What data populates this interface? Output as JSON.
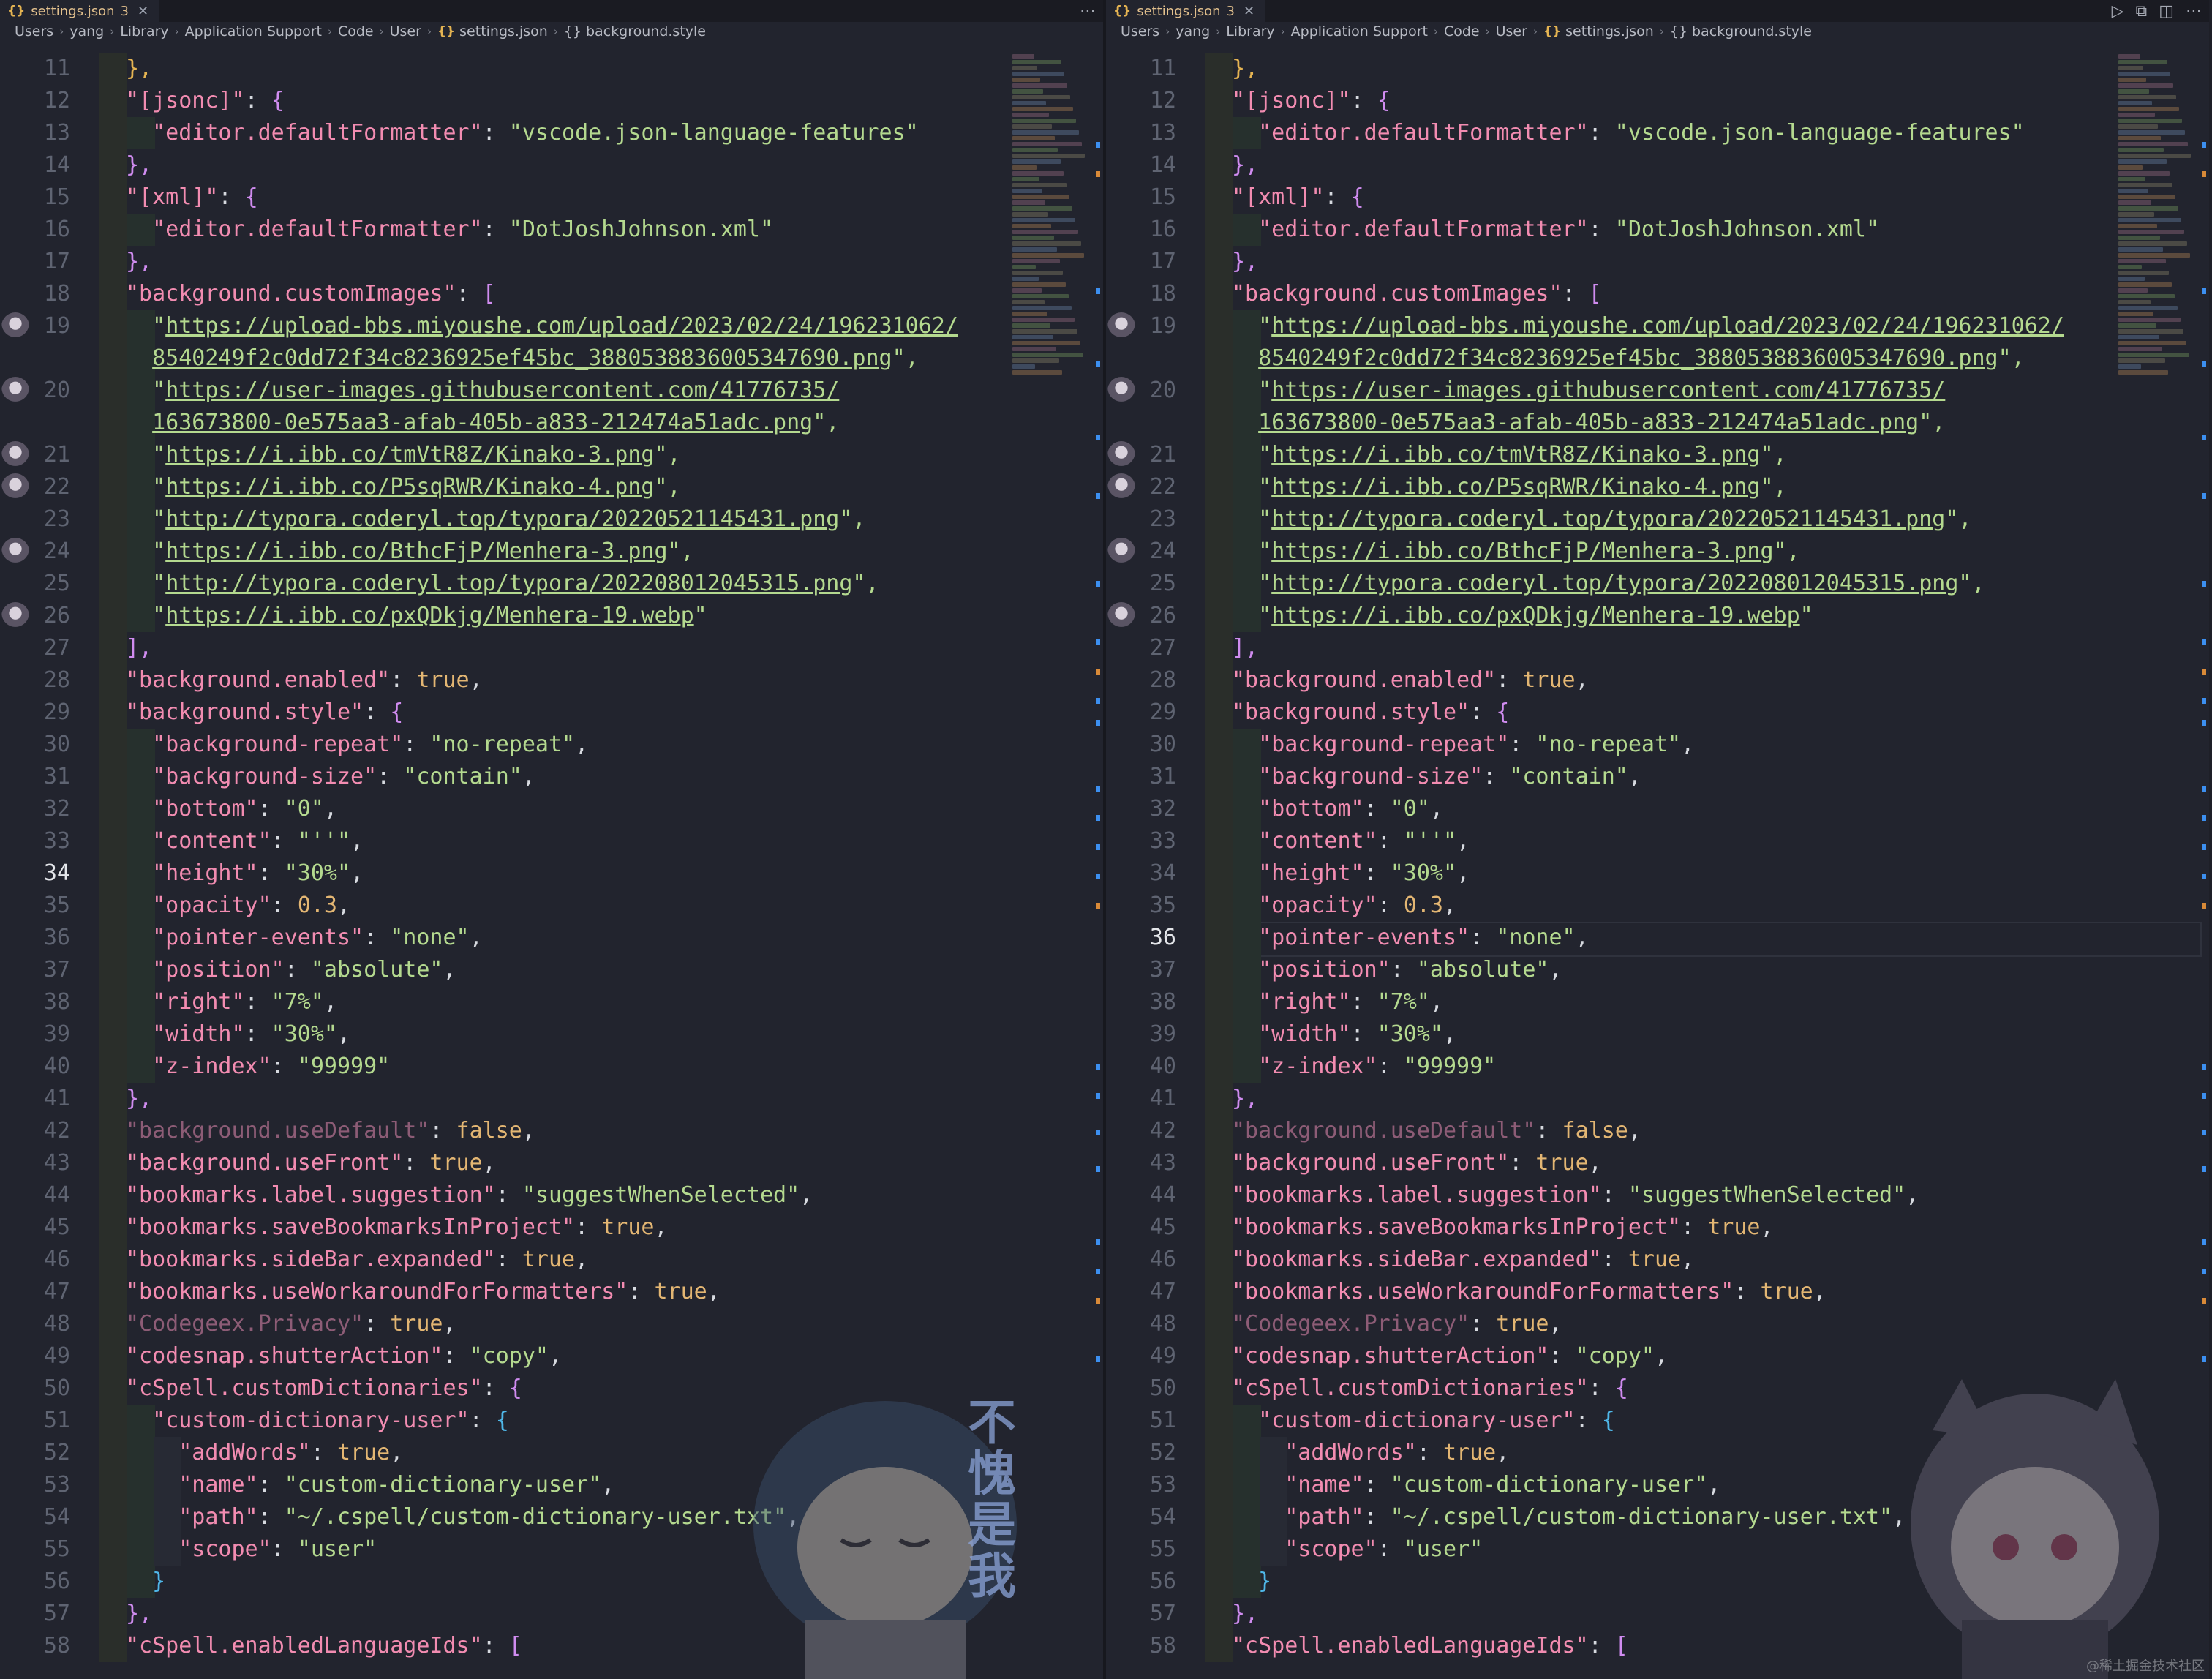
{
  "tab": {
    "icon": "{}",
    "filename": "settings.json",
    "problem_count": "3"
  },
  "breadcrumb": {
    "segments": [
      "Users",
      "yang",
      "Library",
      "Application Support",
      "Code",
      "User"
    ],
    "file": "settings.json",
    "symbol_icon": "{}",
    "symbol": "background.style"
  },
  "lines": [
    {
      "n": 11,
      "spans": [
        [
          "},",
          "brace"
        ]
      ]
    },
    {
      "n": 12,
      "spans": [
        [
          "\"[jsonc]\"",
          "key"
        ],
        [
          ": ",
          "punc"
        ],
        [
          "{",
          "brace2"
        ]
      ]
    },
    {
      "n": 13,
      "spans": [
        [
          "  \"editor.defaultFormatter\"",
          "key"
        ],
        [
          ": ",
          "punc"
        ],
        [
          "\"vscode.json-language-features\"",
          "str"
        ]
      ]
    },
    {
      "n": 14,
      "spans": [
        [
          "},",
          "brace2"
        ]
      ]
    },
    {
      "n": 15,
      "spans": [
        [
          "\"[xml]\"",
          "key"
        ],
        [
          ": ",
          "punc"
        ],
        [
          "{",
          "brace2"
        ]
      ]
    },
    {
      "n": 16,
      "spans": [
        [
          "  \"editor.defaultFormatter\"",
          "key"
        ],
        [
          ": ",
          "punc"
        ],
        [
          "\"DotJoshJohnson.xml\"",
          "str"
        ]
      ]
    },
    {
      "n": 17,
      "spans": [
        [
          "},",
          "brace2"
        ]
      ]
    },
    {
      "n": 18,
      "spans": [
        [
          "\"background.customImages\"",
          "key"
        ],
        [
          ": ",
          "punc"
        ],
        [
          "[",
          "brace2"
        ]
      ]
    },
    {
      "n": 19,
      "spans": [
        [
          "  \"",
          "str"
        ],
        [
          "https://upload-bbs.miyoushe.com/upload/2023/02/24/196231062/",
          "url"
        ]
      ]
    },
    {
      "n": null,
      "spans": [
        [
          "  ",
          "punc"
        ],
        [
          "8540249f2c0dd72f34c8236925ef45bc_3880538836005347690.png",
          "url"
        ],
        [
          "\",",
          "str"
        ]
      ]
    },
    {
      "n": 20,
      "spans": [
        [
          "  \"",
          "str"
        ],
        [
          "https://user-images.githubusercontent.com/41776735/",
          "url"
        ]
      ]
    },
    {
      "n": null,
      "spans": [
        [
          "  ",
          "punc"
        ],
        [
          "163673800-0e575aa3-afab-405b-a833-212474a51adc.png",
          "url"
        ],
        [
          "\",",
          "str"
        ]
      ]
    },
    {
      "n": 21,
      "spans": [
        [
          "  \"",
          "str"
        ],
        [
          "https://i.ibb.co/tmVtR8Z/Kinako-3.png",
          "url"
        ],
        [
          "\",",
          "str"
        ]
      ]
    },
    {
      "n": 22,
      "spans": [
        [
          "  \"",
          "str"
        ],
        [
          "https://i.ibb.co/P5sqRWR/Kinako-4.png",
          "url"
        ],
        [
          "\",",
          "str"
        ]
      ]
    },
    {
      "n": 23,
      "spans": [
        [
          "  \"",
          "str"
        ],
        [
          "http://typora.coderyl.top/typora/20220521145431.png",
          "url"
        ],
        [
          "\",",
          "str"
        ]
      ]
    },
    {
      "n": 24,
      "spans": [
        [
          "  \"",
          "str"
        ],
        [
          "https://i.ibb.co/BthcFjP/Menhera-3.png",
          "url"
        ],
        [
          "\",",
          "str"
        ]
      ]
    },
    {
      "n": 25,
      "spans": [
        [
          "  \"",
          "str"
        ],
        [
          "http://typora.coderyl.top/typora/202208012045315.png",
          "url"
        ],
        [
          "\",",
          "str"
        ]
      ]
    },
    {
      "n": 26,
      "spans": [
        [
          "  \"",
          "str"
        ],
        [
          "https://i.ibb.co/pxQDkjg/Menhera-19.webp",
          "url"
        ],
        [
          "\"",
          "str"
        ]
      ]
    },
    {
      "n": 27,
      "spans": [
        [
          "],",
          "brace2"
        ]
      ]
    },
    {
      "n": 28,
      "spans": [
        [
          "\"background.enabled\"",
          "key"
        ],
        [
          ": ",
          "punc"
        ],
        [
          "true",
          "bool"
        ],
        [
          ",",
          "punc"
        ]
      ]
    },
    {
      "n": 29,
      "spans": [
        [
          "\"background.style\"",
          "key"
        ],
        [
          ": ",
          "punc"
        ],
        [
          "{",
          "brace2"
        ]
      ]
    },
    {
      "n": 30,
      "spans": [
        [
          "  \"background-repeat\"",
          "key"
        ],
        [
          ": ",
          "punc"
        ],
        [
          "\"no-repeat\"",
          "str"
        ],
        [
          ",",
          "punc"
        ]
      ]
    },
    {
      "n": 31,
      "spans": [
        [
          "  \"background-size\"",
          "key"
        ],
        [
          ": ",
          "punc"
        ],
        [
          "\"contain\"",
          "str"
        ],
        [
          ",",
          "punc"
        ]
      ]
    },
    {
      "n": 32,
      "spans": [
        [
          "  \"bottom\"",
          "key"
        ],
        [
          ": ",
          "punc"
        ],
        [
          "\"0\"",
          "str"
        ],
        [
          ",",
          "punc"
        ]
      ]
    },
    {
      "n": 33,
      "spans": [
        [
          "  \"content\"",
          "key"
        ],
        [
          ": ",
          "punc"
        ],
        [
          "\"''\"",
          "str"
        ],
        [
          ",",
          "punc"
        ]
      ]
    },
    {
      "n": 34,
      "spans": [
        [
          "  \"height\"",
          "key"
        ],
        [
          ": ",
          "punc"
        ],
        [
          "\"30%\"",
          "str"
        ],
        [
          ",",
          "punc"
        ]
      ]
    },
    {
      "n": 35,
      "spans": [
        [
          "  \"opacity\"",
          "key"
        ],
        [
          ": ",
          "punc"
        ],
        [
          "0.3",
          "num"
        ],
        [
          ",",
          "punc"
        ]
      ]
    },
    {
      "n": 36,
      "spans": [
        [
          "  \"pointer-events\"",
          "key"
        ],
        [
          ": ",
          "punc"
        ],
        [
          "\"none\"",
          "str"
        ],
        [
          ",",
          "punc"
        ]
      ]
    },
    {
      "n": 37,
      "spans": [
        [
          "  \"position\"",
          "key"
        ],
        [
          ": ",
          "punc"
        ],
        [
          "\"absolute\"",
          "str"
        ],
        [
          ",",
          "punc"
        ]
      ]
    },
    {
      "n": 38,
      "spans": [
        [
          "  \"right\"",
          "key"
        ],
        [
          ": ",
          "punc"
        ],
        [
          "\"7%\"",
          "str"
        ],
        [
          ",",
          "punc"
        ]
      ]
    },
    {
      "n": 39,
      "spans": [
        [
          "  \"width\"",
          "key"
        ],
        [
          ": ",
          "punc"
        ],
        [
          "\"30%\"",
          "str"
        ],
        [
          ",",
          "punc"
        ]
      ]
    },
    {
      "n": 40,
      "spans": [
        [
          "  \"z-index\"",
          "key"
        ],
        [
          ": ",
          "punc"
        ],
        [
          "\"99999\"",
          "str"
        ]
      ]
    },
    {
      "n": 41,
      "spans": [
        [
          "},",
          "brace2"
        ]
      ]
    },
    {
      "n": 42,
      "spans": [
        [
          "\"background.useDefault\"",
          "dim"
        ],
        [
          ": ",
          "punc"
        ],
        [
          "false",
          "bool"
        ],
        [
          ",",
          "punc"
        ]
      ]
    },
    {
      "n": 43,
      "spans": [
        [
          "\"background.useFront\"",
          "key"
        ],
        [
          ": ",
          "punc"
        ],
        [
          "true",
          "bool"
        ],
        [
          ",",
          "punc"
        ]
      ]
    },
    {
      "n": 44,
      "spans": [
        [
          "\"bookmarks.label.suggestion\"",
          "key"
        ],
        [
          ": ",
          "punc"
        ],
        [
          "\"suggestWhenSelected\"",
          "str"
        ],
        [
          ",",
          "punc"
        ]
      ]
    },
    {
      "n": 45,
      "spans": [
        [
          "\"bookmarks.saveBookmarksInProject\"",
          "key"
        ],
        [
          ": ",
          "punc"
        ],
        [
          "true",
          "bool"
        ],
        [
          ",",
          "punc"
        ]
      ]
    },
    {
      "n": 46,
      "spans": [
        [
          "\"bookmarks.sideBar.expanded\"",
          "key"
        ],
        [
          ": ",
          "punc"
        ],
        [
          "true",
          "bool"
        ],
        [
          ",",
          "punc"
        ]
      ]
    },
    {
      "n": 47,
      "spans": [
        [
          "\"bookmarks.useWorkaroundForFormatters\"",
          "key"
        ],
        [
          ": ",
          "punc"
        ],
        [
          "true",
          "bool"
        ],
        [
          ",",
          "punc"
        ]
      ]
    },
    {
      "n": 48,
      "spans": [
        [
          "\"Codegeex.Privacy\"",
          "dim"
        ],
        [
          ": ",
          "punc"
        ],
        [
          "true",
          "bool"
        ],
        [
          ",",
          "punc"
        ]
      ]
    },
    {
      "n": 49,
      "spans": [
        [
          "\"codesnap.shutterAction\"",
          "key"
        ],
        [
          ": ",
          "punc"
        ],
        [
          "\"copy\"",
          "str"
        ],
        [
          ",",
          "punc"
        ]
      ]
    },
    {
      "n": 50,
      "spans": [
        [
          "\"cSpell.customDictionaries\"",
          "key"
        ],
        [
          ": ",
          "punc"
        ],
        [
          "{",
          "brace2"
        ]
      ]
    },
    {
      "n": 51,
      "spans": [
        [
          "  \"custom-dictionary-user\"",
          "key"
        ],
        [
          ": ",
          "punc"
        ],
        [
          "{",
          "brace3"
        ]
      ]
    },
    {
      "n": 52,
      "spans": [
        [
          "    \"addWords\"",
          "key"
        ],
        [
          ": ",
          "punc"
        ],
        [
          "true",
          "bool"
        ],
        [
          ",",
          "punc"
        ]
      ]
    },
    {
      "n": 53,
      "spans": [
        [
          "    \"name\"",
          "key"
        ],
        [
          ": ",
          "punc"
        ],
        [
          "\"custom-dictionary-user\"",
          "str"
        ],
        [
          ",",
          "punc"
        ]
      ]
    },
    {
      "n": 54,
      "spans": [
        [
          "    \"path\"",
          "key"
        ],
        [
          ": ",
          "punc"
        ],
        [
          "\"~/.cspell/custom-dictionary-user.txt\"",
          "str"
        ],
        [
          ",",
          "punc"
        ]
      ]
    },
    {
      "n": 55,
      "spans": [
        [
          "    \"scope\"",
          "key"
        ],
        [
          ": ",
          "punc"
        ],
        [
          "\"user\"",
          "str"
        ]
      ]
    },
    {
      "n": 56,
      "spans": [
        [
          "  }",
          "brace3"
        ]
      ]
    },
    {
      "n": 57,
      "spans": [
        [
          "},",
          "brace2"
        ]
      ]
    },
    {
      "n": 58,
      "spans": [
        [
          "\"cSpell.enabledLanguageIds\"",
          "key"
        ],
        [
          ": ",
          "punc"
        ],
        [
          "[",
          "brace2"
        ]
      ]
    }
  ],
  "panes": [
    {
      "id": "left",
      "active_line": 34,
      "show_actions": false
    },
    {
      "id": "right",
      "active_line": 36,
      "show_actions": true
    }
  ],
  "left_sticker_text": [
    "不",
    "愧",
    "是",
    "我"
  ],
  "right_sticker_text": "?",
  "watermark": "@稀土掘金技术社区",
  "colors": {
    "key": "#f28cb1",
    "string": "#b4d98f",
    "number": "#e3b673",
    "brace": "#d08cf0",
    "line_active": "#e4e6ea"
  }
}
